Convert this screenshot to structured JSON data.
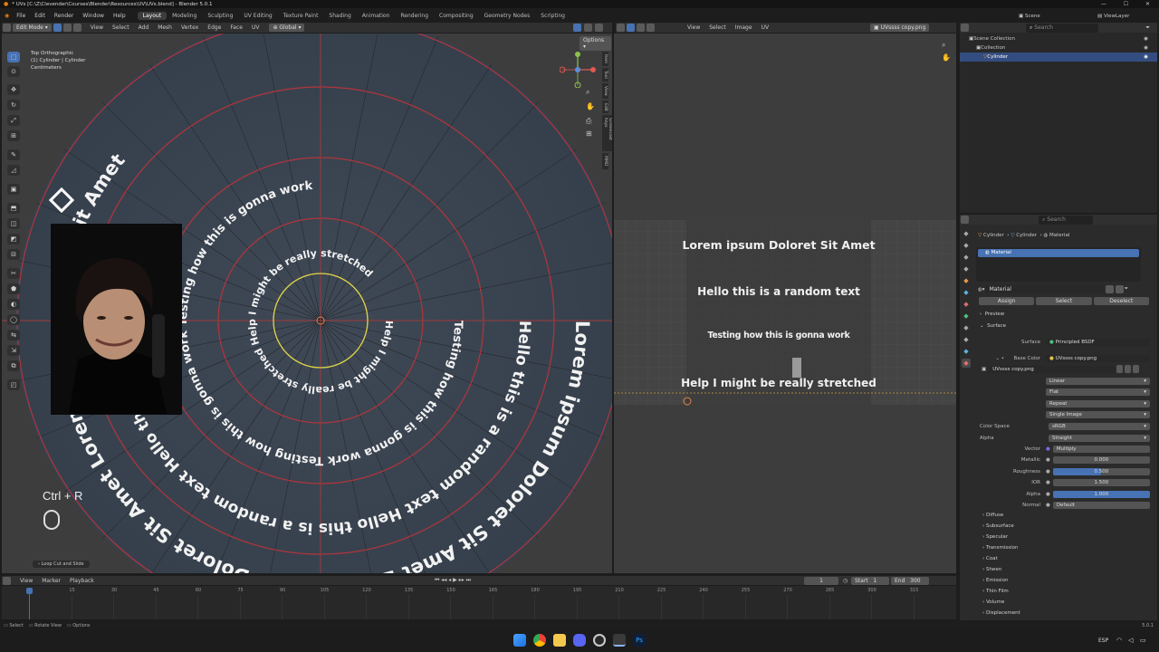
{
  "titlebar": {
    "title": "* UVs [C:\\Z\\Clevender\\Courses\\Blender\\Resources\\UV\\UVs.blend] - Blender 5.0.1",
    "scene": "Scene",
    "view_layer": "ViewLayer"
  },
  "menu": [
    "File",
    "Edit",
    "Render",
    "Window",
    "Help"
  ],
  "workspaces": [
    "Layout",
    "Modeling",
    "Sculpting",
    "UV Editing",
    "Texture Paint",
    "Shading",
    "Animation",
    "Rendering",
    "Compositing",
    "Geometry Nodes",
    "Scripting"
  ],
  "viewport": {
    "mode": "Edit Mode",
    "menus": [
      "View",
      "Select",
      "Add",
      "Mesh",
      "Vertex",
      "Edge",
      "Face",
      "UV"
    ],
    "orientation": "Global",
    "options": "Options",
    "info": [
      "Top Orthographic",
      "(1) Cylinder | Cylinder",
      "Centimeters"
    ],
    "side_tabs": [
      "Item",
      "Tool",
      "View",
      "Edit",
      "Screencast Keys",
      "MMD"
    ],
    "ring_texts": [
      {
        "text": "Lorem ipsum Doloret Sit Amet Lorem ipsum Doloret Sit Amet Lorem ipsum Doloret Sit Amet ",
        "r": 282,
        "size": 21
      },
      {
        "text": "Hello this is a random text Hello this is a random text Hello this is a random text ",
        "r": 220,
        "size": 17
      },
      {
        "text": "Testing how this is gonna work Testing how this is gonna work Testing how this is gonna work ",
        "r": 148,
        "size": 13
      },
      {
        "text": "Help I might be really stretched Help I might be really stretched ",
        "r": 72,
        "size": 11
      }
    ],
    "shortcut": "Ctrl + R",
    "operator": "Loop Cut and Slide"
  },
  "uv_editor": {
    "menus": [
      "View",
      "Select",
      "Image",
      "UV"
    ],
    "image_name": "UVssss copy.png",
    "strips": [
      "Lorem ipsum Doloret Sit Amet",
      "Hello this is a random text",
      "Testing how this is gonna work",
      "Help I might be really stretched"
    ]
  },
  "outliner": {
    "search_placeholder": "Search",
    "items": [
      "Scene Collection",
      "Collection",
      "Cylinder"
    ]
  },
  "properties": {
    "breadcrumb": [
      "Cylinder",
      "Cylinder",
      "Material"
    ],
    "slot": "Material",
    "material_name": "Material",
    "buttons": [
      "Assign",
      "Select",
      "Deselect"
    ],
    "sections": [
      "Preview",
      "Surface"
    ],
    "surface": "Principled BSDF",
    "base_color": "UVssss copy.png",
    "image_name": "UVssss copy.png",
    "image_opts": [
      "Linear",
      "Flat",
      "Repeat",
      "Single Image"
    ],
    "color_space_label": "Color Space",
    "color_space": "sRGB",
    "alpha_label": "Alpha",
    "alpha_mode": "Straight",
    "fields": [
      {
        "label": "Vector",
        "value": "Multiply",
        "kind": "text"
      },
      {
        "label": "Metallic",
        "value": "0.000",
        "kind": "num"
      },
      {
        "label": "Roughness",
        "value": "0.500",
        "kind": "blue",
        "fill": 0.5
      },
      {
        "label": "IOR",
        "value": "1.500",
        "kind": "num"
      },
      {
        "label": "Alpha",
        "value": "1.000",
        "kind": "blue",
        "fill": 1.0
      },
      {
        "label": "Normal",
        "value": "Default",
        "kind": "text"
      }
    ],
    "subsections": [
      "Diffuse",
      "Subsurface",
      "Specular",
      "Transmission",
      "Coat",
      "Sheen",
      "Emission",
      "Thin Film",
      "Volume",
      "Displacement"
    ]
  },
  "timeline": {
    "menus": [
      "View",
      "Marker",
      "Playback"
    ],
    "frame": "1",
    "start_label": "Start",
    "start": "1",
    "end_label": "End",
    "end": "300",
    "ticks": [
      "1",
      "15",
      "30",
      "45",
      "60",
      "75",
      "90",
      "105",
      "120",
      "135",
      "150",
      "165",
      "180",
      "195",
      "210",
      "225",
      "240",
      "255",
      "270",
      "285",
      "300",
      "315"
    ]
  },
  "statusbar": {
    "items": [
      "Select",
      "Rotate View",
      "Options"
    ],
    "version": "5.0.1"
  },
  "taskbar": {
    "lang": "ESP"
  }
}
